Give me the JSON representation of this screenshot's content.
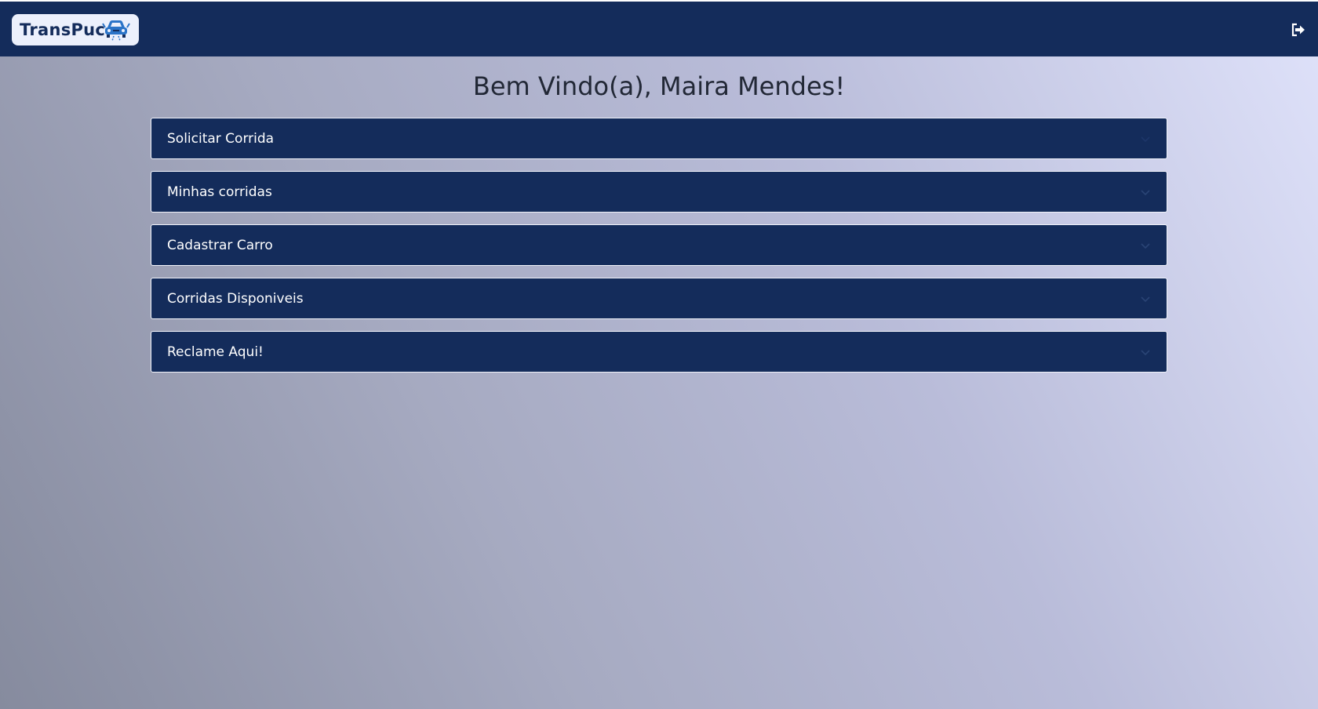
{
  "header": {
    "logo_text": "TransPuc",
    "logo_icon": "car-icon",
    "logout_icon": "logout-icon",
    "bar_color": "#142c5b"
  },
  "main": {
    "welcome": "Bem Vindo(a), Maira Mendes!",
    "accordion": [
      {
        "label": "Solicitar Corrida",
        "icon": "chevron-down-icon"
      },
      {
        "label": "Minhas corridas",
        "icon": "chevron-down-icon"
      },
      {
        "label": "Cadastrar Carro",
        "icon": "chevron-down-icon"
      },
      {
        "label": "Corridas Disponiveis",
        "icon": "chevron-down-icon"
      },
      {
        "label": "Reclame Aqui!",
        "icon": "chevron-down-icon"
      }
    ]
  },
  "colors": {
    "primary": "#142c5b",
    "accent_icon": "#2b74c8",
    "text_dark": "#222836"
  }
}
